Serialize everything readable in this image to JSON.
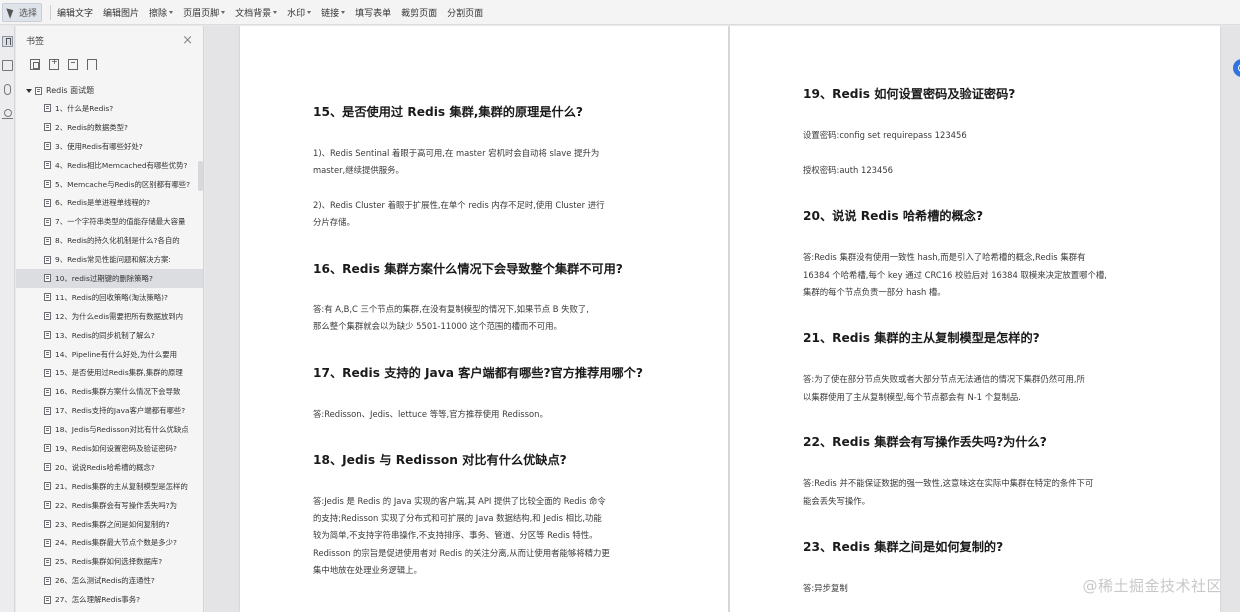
{
  "toolbar": {
    "select_label": "选择",
    "items": [
      {
        "label": "编辑文字",
        "dropdown": false
      },
      {
        "label": "编辑图片",
        "dropdown": false
      },
      {
        "label": "擦除",
        "dropdown": true
      },
      {
        "label": "页眉页脚",
        "dropdown": true
      },
      {
        "label": "文档背景",
        "dropdown": true
      },
      {
        "label": "水印",
        "dropdown": true
      },
      {
        "label": "链接",
        "dropdown": true
      },
      {
        "label": "填写表单",
        "dropdown": false
      },
      {
        "label": "裁剪页面",
        "dropdown": false
      },
      {
        "label": "分割页面",
        "dropdown": false
      }
    ]
  },
  "bookmarks": {
    "title": "书签",
    "root": "Redis 面试题",
    "active_index": 9,
    "items": [
      "1、什么是Redis?",
      "2、Redis的数据类型?",
      "3、使用Redis有哪些好处?",
      "4、Redis相比Memcached有哪些优势?",
      "5、Memcache与Redis的区别都有哪些?",
      "6、Redis是单进程单线程的?",
      "7、一个字符串类型的值能存储最大容量",
      "8、Redis的持久化机制是什么?各自的",
      "9、Redis常见性能问题和解决方案:",
      "10、redis过期键的删除策略?",
      "11、Redis的回收策略(淘汰策略)?",
      "12、为什么edis需要把所有数据放到内",
      "13、Redis的同步机制了解么?",
      "14、Pipeline有什么好处,为什么要用",
      "15、是否使用过Redis集群,集群的原理",
      "16、Redis集群方案什么情况下会导致",
      "17、Redis支持的Java客户端都有哪些?",
      "18、Jedis与Redisson对比有什么优缺点",
      "19、Redis如何设置密码及验证密码?",
      "20、说说Redis哈希槽的概念?",
      "21、Redis集群的主从复制模型是怎样的",
      "22、Redis集群会有写操作丢失吗?为",
      "23、Redis集群之间是如何复制的?",
      "24、Redis集群最大节点个数是多少?",
      "25、Redis集群如何选择数据库?",
      "26、怎么测试Redis的连通性?",
      "27、怎么理解Redis事务?"
    ]
  },
  "page_left": {
    "q15_title": "15、是否使用过 Redis 集群,集群的原理是什么?",
    "q15_p1_l1": "1)、Redis Sentinal 着眼于高可用,在 master 宕机时会自动将 slave 提升为",
    "q15_p1_l2": "master,继续提供服务。",
    "q15_p2_l1": "2)、Redis Cluster 着眼于扩展性,在单个 redis 内存不足时,使用 Cluster 进行",
    "q15_p2_l2": "分片存储。",
    "q16_title": "16、Redis 集群方案什么情况下会导致整个集群不可用?",
    "q16_l1": "答:有 A,B,C 三个节点的集群,在没有复制模型的情况下,如果节点 B 失败了,",
    "q16_l2": "那么整个集群就会以为缺少 5501-11000 这个范围的槽而不可用。",
    "q17_title": "17、Redis 支持的 Java 客户端都有哪些?官方推荐用哪个?",
    "q17_l1": "答:Redisson、Jedis、lettuce 等等,官方推荐使用 Redisson。",
    "q18_title": "18、Jedis 与 Redisson 对比有什么优缺点?",
    "q18_l1": "答:Jedis 是 Redis 的 Java 实现的客户端,其 API 提供了比较全面的 Redis 命令",
    "q18_l2": "的支持;Redisson 实现了分布式和可扩展的 Java 数据结构,和 Jedis 相比,功能",
    "q18_l3": "较为简单,不支持字符串操作,不支持排序、事务、管道、分区等 Redis 特性。",
    "q18_l4": "Redisson 的宗旨是促进使用者对 Redis 的关注分离,从而让使用者能够将精力更",
    "q18_l5": "集中地放在处理业务逻辑上。"
  },
  "page_right": {
    "q19_title": "19、Redis 如何设置密码及验证密码?",
    "q19_l1": "设置密码:config set requirepass 123456",
    "q19_l2": "授权密码:auth 123456",
    "q20_title": "20、说说 Redis 哈希槽的概念?",
    "q20_l1": "答:Redis 集群没有使用一致性 hash,而是引入了哈希槽的概念,Redis 集群有",
    "q20_l2": "16384 个哈希槽,每个 key 通过 CRC16 校验后对 16384 取模来决定放置哪个槽,",
    "q20_l3": "集群的每个节点负责一部分 hash 槽。",
    "q21_title": "21、Redis 集群的主从复制模型是怎样的?",
    "q21_l1": "答:为了使在部分节点失败或者大部分节点无法通信的情况下集群仍然可用,所",
    "q21_l2": "以集群使用了主从复制模型,每个节点都会有 N-1 个复制品.",
    "q22_title": "22、Redis 集群会有写操作丢失吗?为什么?",
    "q22_l1": "答:Redis 并不能保证数据的强一致性,这意味这在实际中集群在特定的条件下可",
    "q22_l2": "能会丢失写操作。",
    "q23_title": "23、Redis 集群之间是如何复制的?",
    "q23_l1": "答:异步复制"
  },
  "watermark": "@稀土掘金技术社区"
}
